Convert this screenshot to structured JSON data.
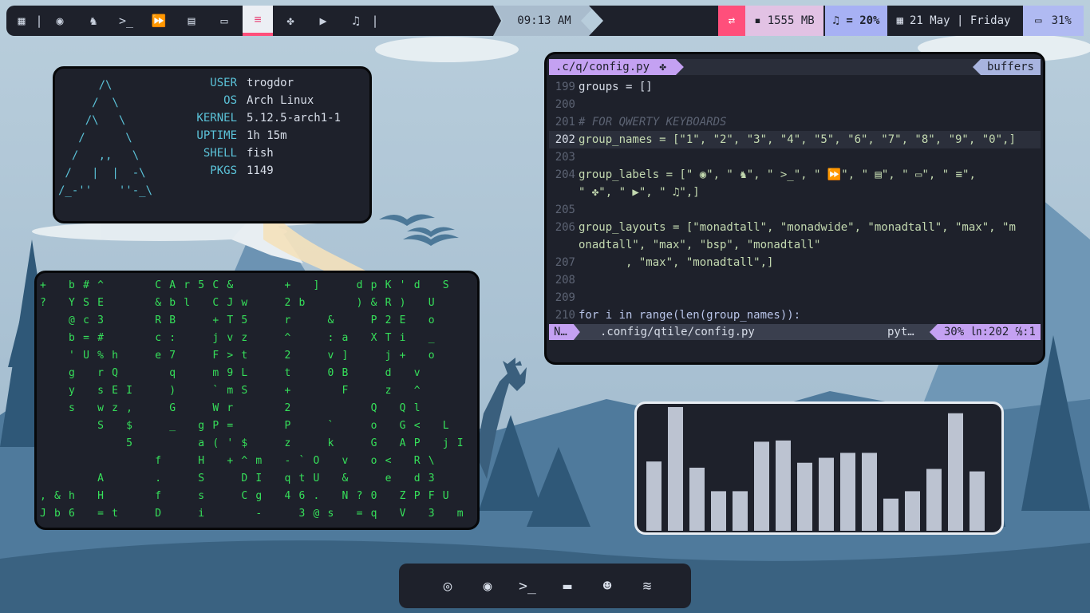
{
  "topbar": {
    "workspaces": [
      {
        "icon": "layout-icon",
        "glyph": "▦"
      },
      {
        "icon": "separator",
        "glyph": "|"
      },
      {
        "icon": "firefox-icon",
        "glyph": "◉"
      },
      {
        "icon": "ghost-icon",
        "glyph": "♞"
      },
      {
        "icon": "terminal-icon",
        "glyph": ">_"
      },
      {
        "icon": "fast-forward-icon",
        "glyph": "⏩"
      },
      {
        "icon": "document-icon",
        "glyph": "▤"
      },
      {
        "icon": "folder-open-icon",
        "glyph": "▭"
      },
      {
        "icon": "sliders-icon",
        "glyph": "≡"
      },
      {
        "icon": "python-icon",
        "glyph": "✤"
      },
      {
        "icon": "video-icon",
        "glyph": "▶"
      },
      {
        "icon": "music-icon",
        "glyph": "♫"
      },
      {
        "icon": "separator",
        "glyph": "|"
      }
    ],
    "clock": "09:13 AM",
    "memory": "1555 MB",
    "volume": "♫ = 20%",
    "date": "21 May | Friday",
    "battery": "31%",
    "colors": {
      "accent_pink": "#ff4f7b",
      "memory_bg": "#e2c2e4",
      "volume_bg": "#a7b1f4",
      "battery_bg": "#b0baf2"
    }
  },
  "neofetch": {
    "art": "      /\\\n     /  \\\n    /\\   \\\n   /      \\\n  /   ,,   \\\n /   |  |  -\\\n/_-''    ''-_\\",
    "rows": [
      {
        "key": "USER",
        "value": "trogdor"
      },
      {
        "key": "OS",
        "value": "Arch Linux"
      },
      {
        "key": "KERNEL",
        "value": "5.12.5-arch1-1"
      },
      {
        "key": "UPTIME",
        "value": "1h 15m"
      },
      {
        "key": "SHELL",
        "value": "fish"
      },
      {
        "key": "PKGS",
        "value": "1149"
      }
    ]
  },
  "matrix": {
    "rows": [
      "+ b#^   CAr5C&   + ]  dpK'd S",
      "? YSE   &bl CJw  2b   )&R) U",
      "  @c3   RB  +T5  r  &  P2E o",
      "  b=#   c:  jvz  ^  :a XTi _",
      "  'U%h  e7  F>t  2  v]  j+ o",
      "  g rQ   q  m9L  t  0B  d v",
      "  y sEI  )  `mS  +   F  z ^",
      "  s wz,  G  Wr   2     Q Ql",
      "    S $  _ gP=   P  `  o G< L",
      "      5    a('$  z  k  G AP jI",
      "        f  H +^m -`O v o< R\\",
      "    A   .  S  DI qtU &  e d3",
      ",&h H   f  s  Cg 46. N?0 ZPFU",
      "Jb6 =t  D  i   -  3@s =q V 3 m"
    ]
  },
  "editor": {
    "tab_file": ".c/q/config.py",
    "tab_buffers": "buffers",
    "lines": [
      {
        "n": "199",
        "text": "groups = []"
      },
      {
        "n": "200",
        "text": ""
      },
      {
        "n": "201",
        "text": "# FOR QWERTY KEYBOARDS"
      },
      {
        "n": "202",
        "text": "group_names = [\"1\", \"2\", \"3\", \"4\", \"5\", \"6\", \"7\", \"8\", \"9\", \"0\",]"
      },
      {
        "n": "203",
        "text": ""
      },
      {
        "n": "204",
        "text": "group_labels = [\" ◉\", \" ♞\", \" >_\", \" ⏩\", \" ▤\", \" ▭\", \" ≡\","
      },
      {
        "n": "",
        "text": "\" ✤\", \" ▶\", \" ♫\",]"
      },
      {
        "n": "205",
        "text": ""
      },
      {
        "n": "206",
        "text": "group_layouts = [\"monadtall\", \"monadwide\", \"monadtall\", \"max\", \"m"
      },
      {
        "n": "",
        "text": "onadtall\", \"max\", \"bsp\", \"monadtall\""
      },
      {
        "n": "207",
        "text": "       , \"max\", \"monadtall\",]"
      },
      {
        "n": "208",
        "text": ""
      },
      {
        "n": "209",
        "text": ""
      },
      {
        "n": "210",
        "text": "for i in range(len(group_names)):"
      }
    ],
    "status": {
      "mode": "N…",
      "path": ".config/qtile/config.py",
      "filetype": "pyt…",
      "position": "30% ㏑:202 ℅:1"
    }
  },
  "visualizer": {
    "chart_data": {
      "type": "bar",
      "values": [
        0.56,
        1.0,
        0.51,
        0.32,
        0.32,
        0.72,
        0.73,
        0.55,
        0.59,
        0.63,
        0.63,
        0.26,
        0.32,
        0.5,
        0.95,
        0.48
      ],
      "ylim": [
        0,
        1
      ]
    },
    "bar_color": "#bcc3d1"
  },
  "dock": {
    "items": [
      {
        "name": "chrome-icon",
        "glyph": "◎"
      },
      {
        "name": "firefox-icon",
        "glyph": "◉"
      },
      {
        "name": "terminal-icon",
        "glyph": ">_"
      },
      {
        "name": "folder-icon",
        "glyph": "▬"
      },
      {
        "name": "discord-icon",
        "glyph": "☻"
      },
      {
        "name": "spotify-icon",
        "glyph": "≋"
      }
    ]
  }
}
